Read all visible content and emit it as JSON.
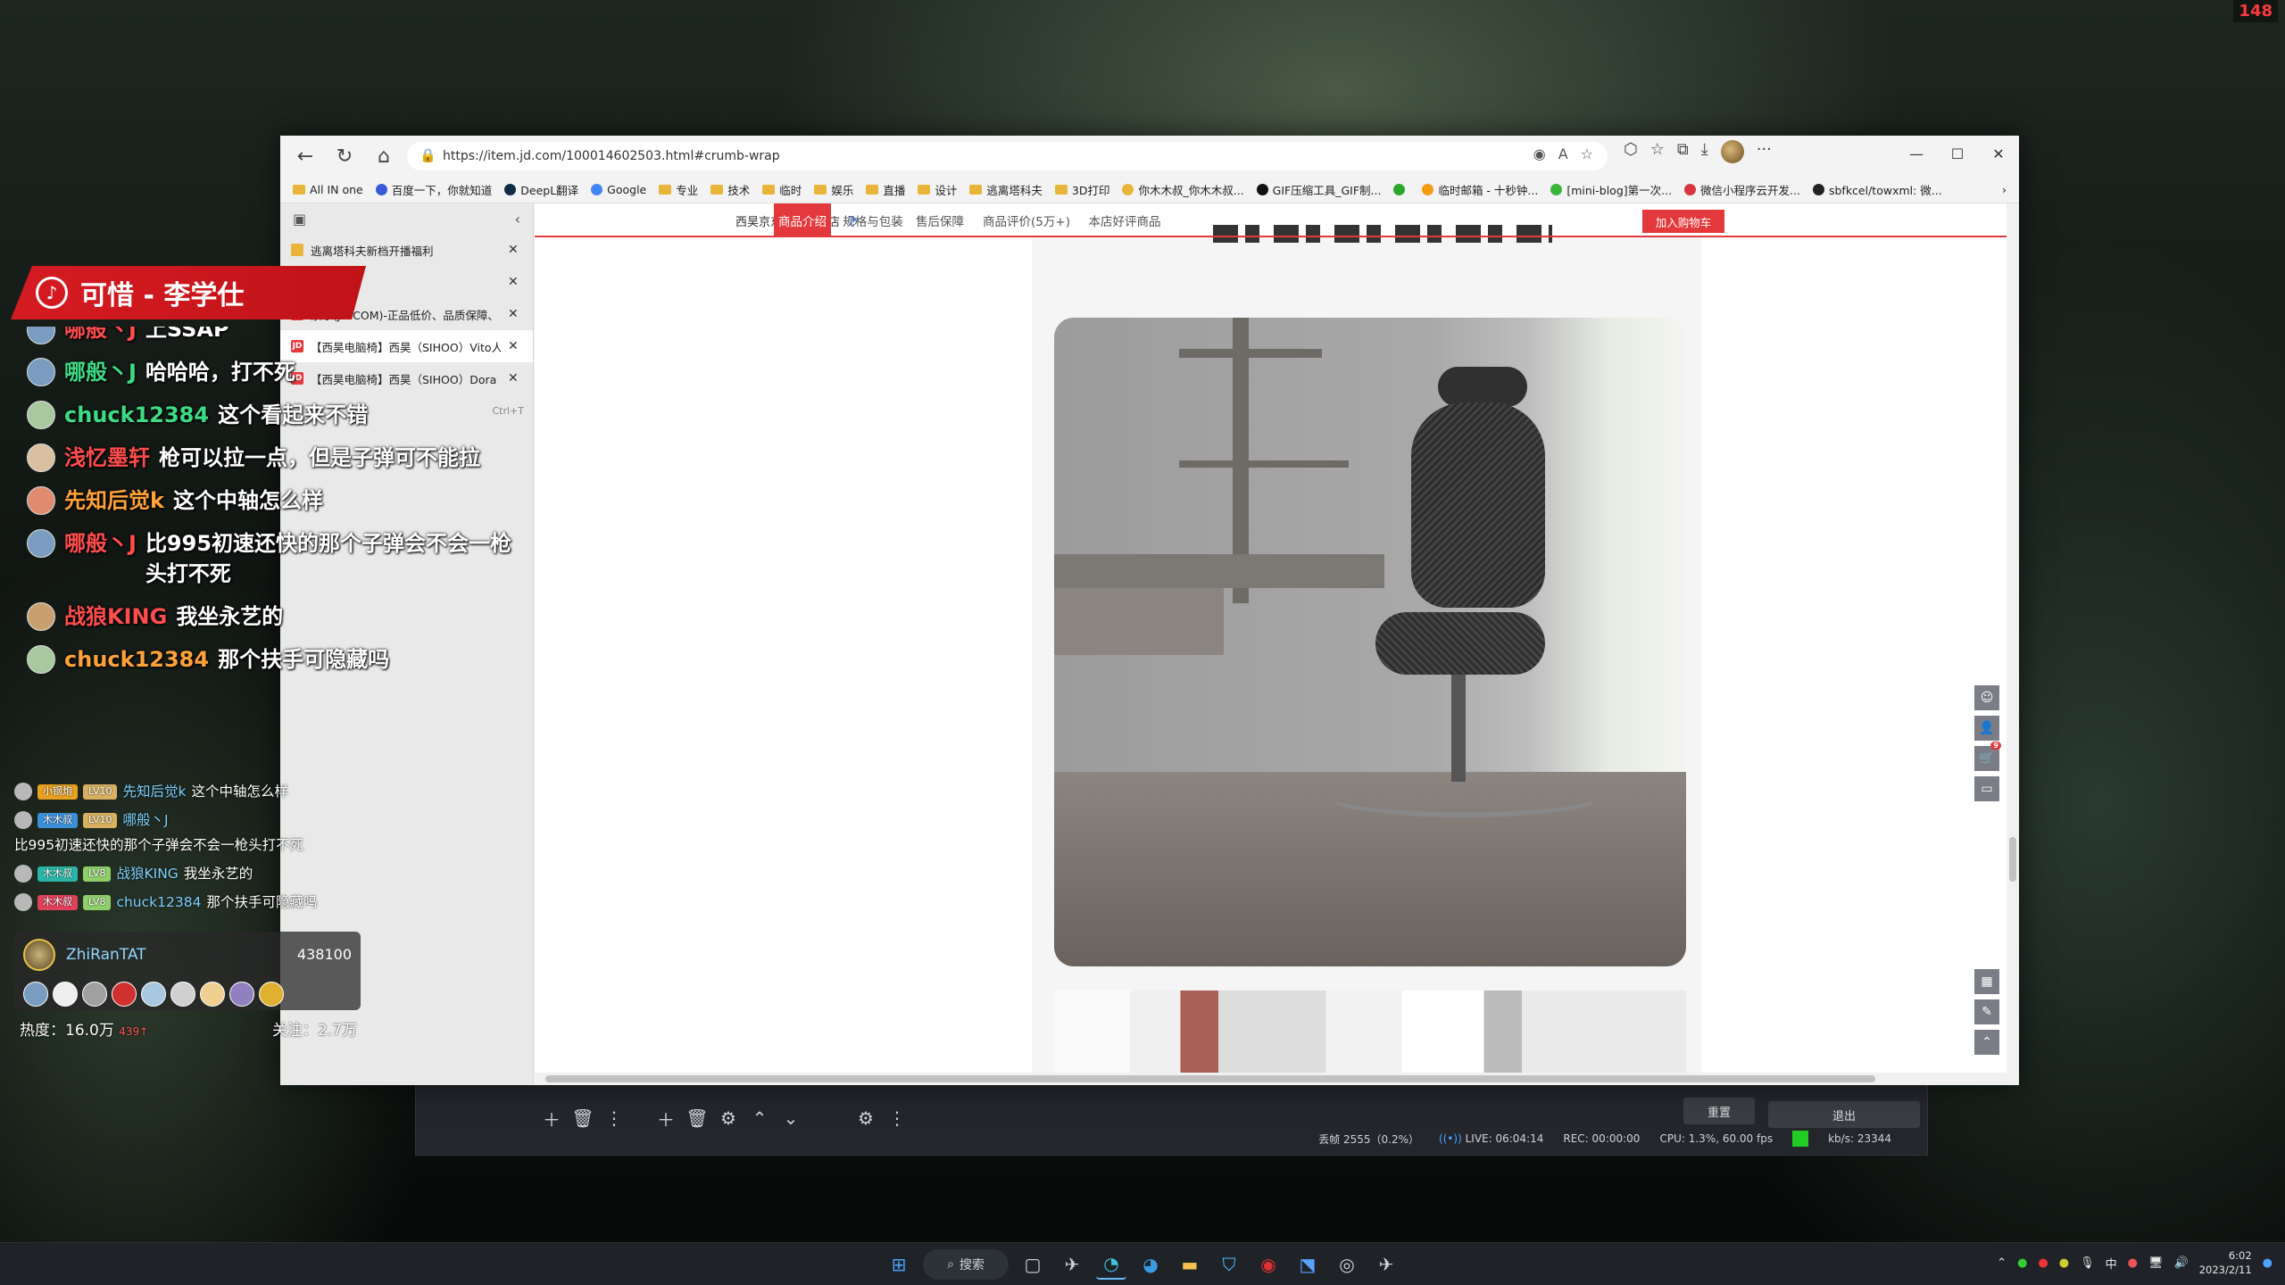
{
  "corner_indicator": "148",
  "browser": {
    "url": "https://item.jd.com/100014602503.html#crumb-wrap",
    "bookmarks": [
      {
        "label": "All IN one",
        "kind": "folder"
      },
      {
        "label": "百度一下，你就知道",
        "kind": "site",
        "color": "#3a5bd9"
      },
      {
        "label": "DeepL翻译",
        "kind": "site",
        "color": "#0f2b46"
      },
      {
        "label": "Google",
        "kind": "site",
        "color": "#4285f4"
      },
      {
        "label": "专业",
        "kind": "folder"
      },
      {
        "label": "技术",
        "kind": "folder"
      },
      {
        "label": "临时",
        "kind": "folder"
      },
      {
        "label": "娱乐",
        "kind": "folder"
      },
      {
        "label": "直播",
        "kind": "folder"
      },
      {
        "label": "设计",
        "kind": "folder"
      },
      {
        "label": "逃离塔科夫",
        "kind": "folder"
      },
      {
        "label": "3D打印",
        "kind": "folder"
      },
      {
        "label": "你木木叔_你木木叔...",
        "kind": "site",
        "color": "#e8b53a"
      },
      {
        "label": "GIF压缩工具_GIF制...",
        "kind": "site",
        "color": "#111111"
      },
      {
        "label": "",
        "kind": "site",
        "color": "#2aa82a"
      },
      {
        "label": "临时邮箱 - 十秒钟...",
        "kind": "site",
        "color": "#f39c12"
      },
      {
        "label": "[mini-blog]第一次...",
        "kind": "site",
        "color": "#3cb43c"
      },
      {
        "label": "微信小程序云开发...",
        "kind": "site",
        "color": "#d9363e"
      },
      {
        "label": "sbfkcel/towxml: 微...",
        "kind": "site",
        "color": "#222222"
      }
    ],
    "tabs": [
      {
        "title": "逃离塔科夫新档开播福利",
        "fav": "#e8b53a",
        "favtext": "",
        "selected": false
      },
      {
        "title": "",
        "fav": "#cccccc",
        "favtext": "",
        "selected": false
      },
      {
        "title": "京东(JD.COM)-正品低价、品质保障、",
        "fav": "#e4393c",
        "favtext": "JD",
        "selected": false
      },
      {
        "title": "【西昊电脑椅】西昊（SIHOO）Vito人",
        "fav": "#e4393c",
        "favtext": "JD",
        "selected": true
      },
      {
        "title": "【西昊电脑椅】西昊（SIHOO）Dora",
        "fav": "#e4393c",
        "favtext": "JD",
        "selected": false
      }
    ],
    "newtab_shortcut": "Ctrl+T"
  },
  "jd": {
    "shop_name": "西昊京东自营旗舰店",
    "tabs": [
      "商品介绍",
      "规格与包装",
      "售后保障",
      "商品评价(5万+)",
      "本店好评商品"
    ],
    "active_tab": 0,
    "add_to_cart": "加入购物车",
    "cart_count": "9"
  },
  "obs": {
    "reset_label": "重置",
    "exit_label": "退出",
    "dropped_frames": "丢帧 2555（0.2%）",
    "live_time": "LIVE: 06:04:14",
    "rec_time": "REC: 00:00:00",
    "cpu": "CPU: 1.3%, 60.00 fps",
    "bitrate": "kb/s: 23344"
  },
  "overlay": {
    "song": "可惜 - 李学仕",
    "chat": [
      {
        "name": "哪般丶J",
        "text": "上SSAP",
        "name_color": "#ff4d4d",
        "avatar": "#7a9cc0"
      },
      {
        "name": "哪般丶J",
        "text": "哈哈哈，打不死",
        "name_color": "#3ddc84",
        "avatar": "#7a9cc0"
      },
      {
        "name": "chuck12384",
        "text": "这个看起来不错",
        "name_color": "#3ddc84",
        "avatar": "#a8c8a0"
      },
      {
        "name": "浅忆墨轩",
        "text": "枪可以拉一点，但是子弹可不能拉",
        "name_color": "#ff4d4d",
        "avatar": "#d8c0a0"
      },
      {
        "name": "先知后觉k",
        "text": "这个中轴怎么样",
        "name_color": "#ffa23a",
        "avatar": "#e08a70"
      },
      {
        "name": "哪般丶J",
        "text": "比995初速还快的那个子弹会不会一枪头打不死",
        "name_color": "#ff4d4d",
        "avatar": "#7a9cc0"
      },
      {
        "name": "战狼KING",
        "text": "我坐永艺的",
        "name_color": "#ff4d4d",
        "avatar": "#c8a070"
      },
      {
        "name": "chuck12384",
        "text": "那个扶手可隐藏吗",
        "name_color": "#ffa23a",
        "avatar": "#a8c8a0"
      }
    ],
    "small_chat": [
      {
        "badges": [
          {
            "t": "小钢炮",
            "c": "#e8a020"
          },
          {
            "t": "LV10",
            "c": "#d8b060"
          }
        ],
        "name": "先知后觉k",
        "text": "这个中轴怎么样"
      },
      {
        "badges": [
          {
            "t": "木木叔",
            "c": "#3b8fd9"
          },
          {
            "t": "LV10",
            "c": "#d8b060"
          }
        ],
        "name": "哪般丶J",
        "text": "比995初速还快的那个子弹会不会一枪头打不死"
      },
      {
        "badges": [
          {
            "t": "木木叔",
            "c": "#29b6a8"
          },
          {
            "t": "LV8",
            "c": "#8fcf6a"
          }
        ],
        "name": "战狼KING",
        "text": "我坐永艺的"
      },
      {
        "badges": [
          {
            "t": "木木叔",
            "c": "#e0405a"
          },
          {
            "t": "LV8",
            "c": "#8fcf6a"
          }
        ],
        "name": "chuck12384",
        "text": "那个扶手可隐藏吗"
      }
    ],
    "top_user": "ZhiRanTAT",
    "top_score": "438100",
    "fans": [
      "#7a9cc0",
      "#eeeeee",
      "#a0a0a0",
      "#d03030",
      "#a8c8e0",
      "#d0d0d0",
      "#f0d090",
      "#9080c0",
      "#e0b030"
    ],
    "heat_label": "热度：16.0万",
    "heat_delta": "439↑",
    "follow_label": "关注：2.7万"
  },
  "taskbar": {
    "search_label": "搜索",
    "time": "6:02",
    "date": "2023/2/11",
    "ime": "中"
  }
}
